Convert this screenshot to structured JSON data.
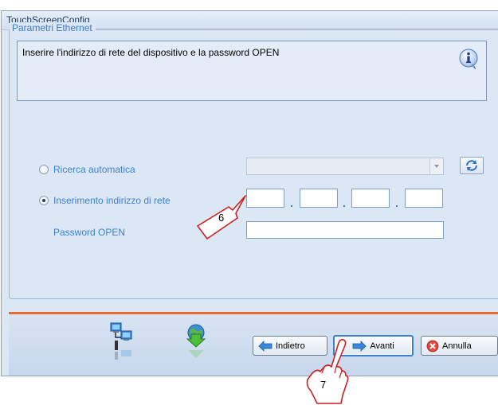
{
  "window": {
    "title": "TouchScreenConfig"
  },
  "group": {
    "legend": "Parametri Ethernet"
  },
  "info": {
    "text": "Inserire l'indirizzo di rete del dispositivo e la password OPEN",
    "icon": "info-icon"
  },
  "options": {
    "auto_search": {
      "label": "Ricerca automatica",
      "selected": false
    },
    "manual_address": {
      "label": "Inserimento indirizzo di rete",
      "selected": true
    },
    "password": {
      "label": "Password OPEN"
    }
  },
  "ip_fields": [
    "",
    "",
    "",
    ""
  ],
  "ip_separator": ".",
  "combo": {
    "value": ""
  },
  "password_value": "",
  "buttons": {
    "back": "Indietro",
    "next": "Avanti",
    "cancel": "Annulla"
  },
  "callouts": {
    "step6": "6",
    "step7": "7"
  },
  "colors": {
    "accent": "#3b7fd0",
    "separator": "#e8692e",
    "window_bg": "#dce7f5"
  }
}
